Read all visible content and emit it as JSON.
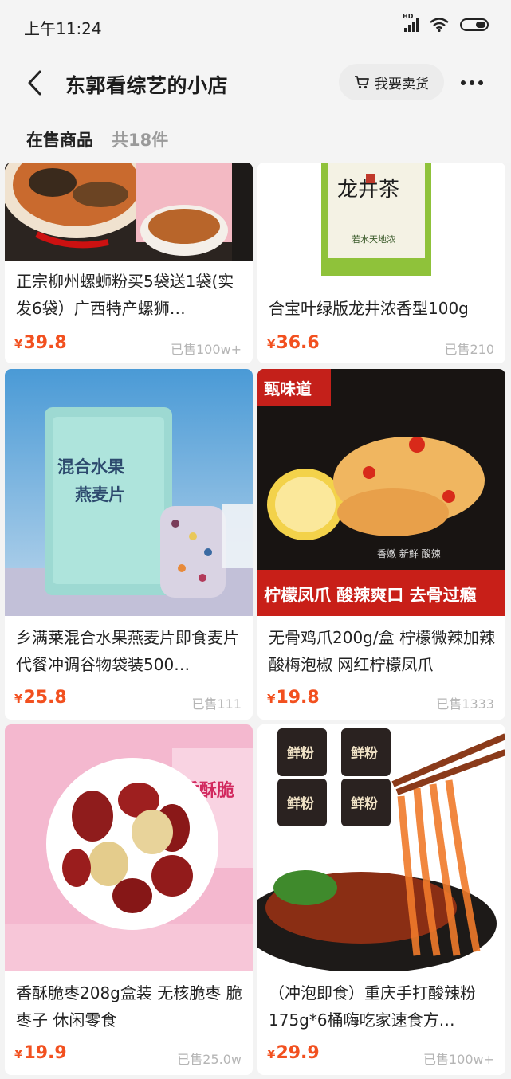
{
  "status_bar": {
    "time": "上午11:24",
    "hd_label": "HD"
  },
  "header": {
    "back_icon": "chevron-left-icon",
    "shop_name": "东郭看综艺的小店",
    "sell_label": "我要卖货",
    "more_icon": "more-dots-icon"
  },
  "section": {
    "title": "在售商品",
    "count": "共18件"
  },
  "products": [
    {
      "name": "正宗柳州螺蛳粉买5袋送1袋(实发6袋）广西特产螺狮…",
      "currency": "¥",
      "price": "39.8",
      "sold": "已售100w+"
    },
    {
      "name": "合宝叶绿版龙井浓香型100g",
      "currency": "¥",
      "price": "36.6",
      "sold": "已售210",
      "image_text": [
        "龙井茶",
        "若水天地浓"
      ]
    },
    {
      "name": "乡满莱混合水果燕麦片即食麦片代餐冲调谷物袋装500…",
      "currency": "¥",
      "price": "25.8",
      "sold": "已售111",
      "image_text": [
        "混合水果",
        "燕麦片"
      ]
    },
    {
      "name": "无骨鸡爪200g/盒 柠檬微辣加辣酸梅泡椒 网红柠檬凤爪",
      "currency": "¥",
      "price": "19.8",
      "sold": "已售1333",
      "image_text": [
        "甄味道",
        "香嫩 新鲜 酸辣",
        "柠檬凤爪 酸辣爽口 去骨过瘾"
      ]
    },
    {
      "name": "香酥脆枣208g盒装 无核脆枣 脆枣子 休闲零食",
      "currency": "¥",
      "price": "19.9",
      "sold": "已售25.0w",
      "image_text": [
        "香酥脆"
      ]
    },
    {
      "name": "（冲泡即食）重庆手打酸辣粉175g*6桶嗨吃家速食方…",
      "currency": "¥",
      "price": "29.9",
      "sold": "已售100w+",
      "image_text": [
        "鲜粉"
      ]
    }
  ],
  "colors": {
    "price": "#f2501f",
    "background": "#f3f3f3",
    "card": "#ffffff"
  }
}
